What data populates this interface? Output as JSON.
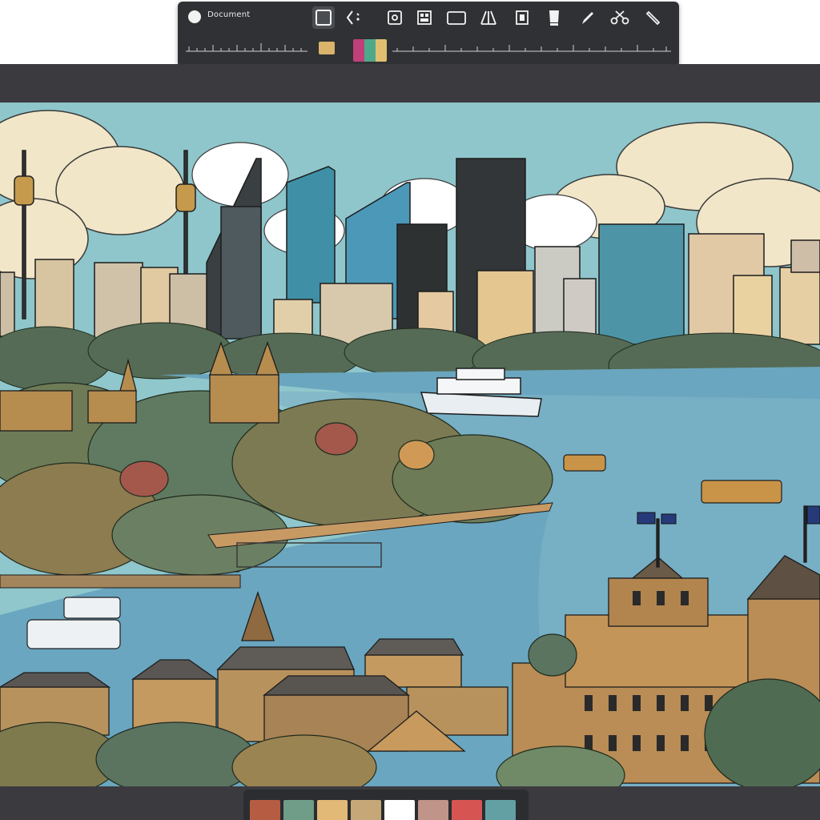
{
  "toolbar": {
    "document_title": "Document",
    "tools": [
      {
        "name": "select-tool",
        "icon": "square-select-icon",
        "active": true
      },
      {
        "name": "lasso-tool",
        "icon": "lasso-icon",
        "active": false
      },
      {
        "name": "layer-tool",
        "icon": "layer-icon",
        "active": false
      },
      {
        "name": "grid-tool",
        "icon": "grid-icon",
        "active": false
      },
      {
        "name": "frame-tool",
        "icon": "frame-icon",
        "active": false
      },
      {
        "name": "perspective-tool",
        "icon": "perspective-icon",
        "active": false
      },
      {
        "name": "crop-tool",
        "icon": "crop-icon",
        "active": false
      },
      {
        "name": "eraser-tool",
        "icon": "eraser-icon",
        "active": false
      },
      {
        "name": "pen-tool",
        "icon": "pen-icon",
        "active": false
      },
      {
        "name": "scissors-tool",
        "icon": "scissors-icon",
        "active": false
      },
      {
        "name": "pencil-tool",
        "icon": "pencil-icon",
        "active": false
      }
    ],
    "primary_color": "#d9b46a",
    "color_strip": [
      "#c0407a",
      "#4ea88a",
      "#e0c070"
    ]
  },
  "palette": {
    "colors": [
      "#b55c43",
      "#6f9d88",
      "#e2b977",
      "#c6a777",
      "#ffffff",
      "#c09488",
      "#d65552",
      "#63a0a4"
    ]
  }
}
